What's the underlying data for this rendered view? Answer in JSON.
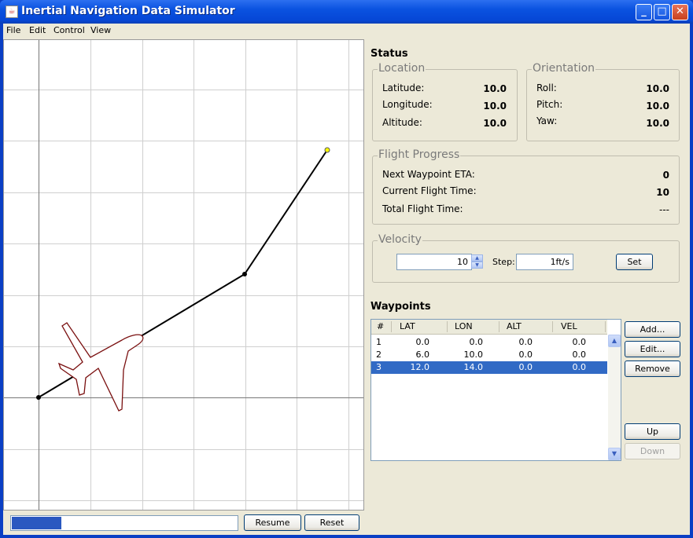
{
  "window": {
    "title": "Inertial Navigation Data Simulator",
    "controls": [
      "minimize-icon",
      "maximize-icon",
      "close-icon"
    ]
  },
  "menu": {
    "items": [
      "File",
      "Edit",
      "Control",
      "View"
    ]
  },
  "map": {
    "route_points": [
      [
        0,
        0
      ],
      [
        6,
        10
      ],
      [
        12,
        14
      ]
    ],
    "colors": {
      "route": "#000000",
      "plane_outline": "#7a1010",
      "end_marker": "#ffff00"
    }
  },
  "bottom": {
    "progress": 0.22,
    "resume_label": "Resume",
    "reset_label": "Reset"
  },
  "status": {
    "title": "Status",
    "location": {
      "legend": "Location",
      "latitude_label": "Latitude:",
      "latitude": "10.0",
      "longitude_label": "Longitude:",
      "longitude": "10.0",
      "altitude_label": "Altitude:",
      "altitude": "10.0"
    },
    "orientation": {
      "legend": "Orientation",
      "roll_label": "Roll:",
      "roll": "10.0",
      "pitch_label": "Pitch:",
      "pitch": "10.0",
      "yaw_label": "Yaw:",
      "yaw": "10.0"
    },
    "flight_progress": {
      "legend": "Flight Progress",
      "eta_label": "Next Waypoint ETA:",
      "eta": "0",
      "current_label": "Current Flight Time:",
      "current": "10",
      "total_label": "Total Flight Time:",
      "total": "---"
    },
    "velocity": {
      "legend": "Velocity",
      "value": "10",
      "step_label": "Step:",
      "step_value": "1ft/s",
      "set_label": "Set"
    }
  },
  "waypoints": {
    "title": "Waypoints",
    "columns": [
      "#",
      "LAT",
      "LON",
      "ALT",
      "VEL"
    ],
    "rows": [
      {
        "num": "1",
        "lat": "0.0",
        "lon": "0.0",
        "alt": "0.0",
        "vel": "0.0"
      },
      {
        "num": "2",
        "lat": "6.0",
        "lon": "10.0",
        "alt": "0.0",
        "vel": "0.0"
      },
      {
        "num": "3",
        "lat": "12.0",
        "lon": "14.0",
        "alt": "0.0",
        "vel": "0.0"
      }
    ],
    "selected_row": 2,
    "buttons": {
      "add": "Add...",
      "edit": "Edit...",
      "remove": "Remove",
      "up": "Up",
      "down": "Down"
    }
  }
}
